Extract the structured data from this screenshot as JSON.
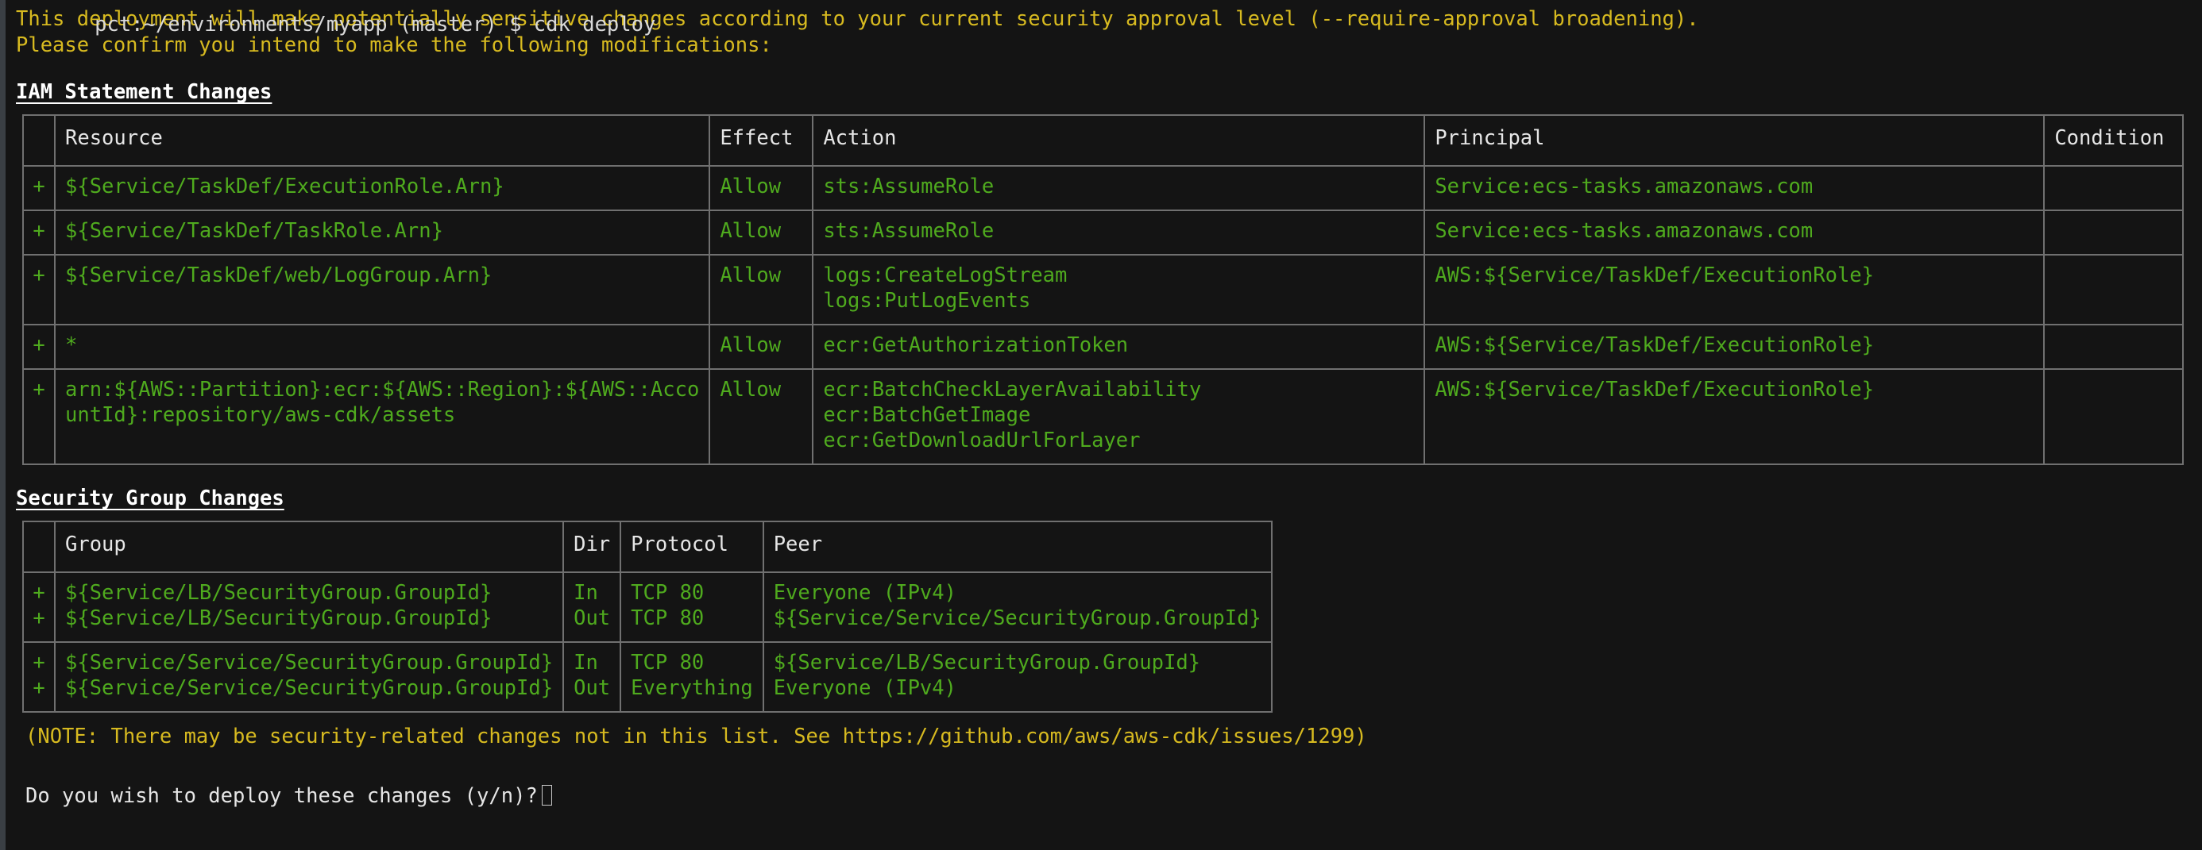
{
  "terminal": {
    "prompt_line_clipped": "pct:~/environments/myapp (master) $ cdk deploy",
    "warning_line_1": "This deployment will make potentially sensitive changes according to your current security approval level (--require-approval broadening).",
    "warning_line_2": "Please confirm you intend to make the following modifications:",
    "note": "(NOTE: There may be security-related changes not in this list. See https://github.com/aws/aws-cdk/issues/1299)",
    "confirm_prompt": "Do you wish to deploy these changes (y/n)?",
    "colors": {
      "background": "#141414",
      "warning": "#d7ba20",
      "added": "#4faa1e",
      "header_text": "#e6e6e6",
      "border": "#707070"
    }
  },
  "iam_section": {
    "title": "IAM Statement Changes",
    "columns": [
      "",
      "Resource",
      "Effect",
      "Action",
      "Principal",
      "Condition"
    ],
    "rows": [
      {
        "sign": "+",
        "resource": "${Service/TaskDef/ExecutionRole.Arn}",
        "effect": "Allow",
        "action": "sts:AssumeRole",
        "principal": "Service:ecs-tasks.amazonaws.com",
        "condition": ""
      },
      {
        "sign": "+",
        "resource": "${Service/TaskDef/TaskRole.Arn}",
        "effect": "Allow",
        "action": "sts:AssumeRole",
        "principal": "Service:ecs-tasks.amazonaws.com",
        "condition": ""
      },
      {
        "sign": "+",
        "resource": "${Service/TaskDef/web/LogGroup.Arn}",
        "effect": "Allow",
        "action": "logs:CreateLogStream\nlogs:PutLogEvents",
        "principal": "AWS:${Service/TaskDef/ExecutionRole}",
        "condition": ""
      },
      {
        "sign": "+",
        "resource": "*",
        "effect": "Allow",
        "action": "ecr:GetAuthorizationToken",
        "principal": "AWS:${Service/TaskDef/ExecutionRole}",
        "condition": ""
      },
      {
        "sign": "+",
        "resource": "arn:${AWS::Partition}:ecr:${AWS::Region}:${AWS::Acco\nuntId}:repository/aws-cdk/assets",
        "effect": "Allow",
        "action": "ecr:BatchCheckLayerAvailability\necr:BatchGetImage\necr:GetDownloadUrlForLayer",
        "principal": "AWS:${Service/TaskDef/ExecutionRole}",
        "condition": ""
      }
    ]
  },
  "sg_section": {
    "title": "Security Group Changes",
    "columns": [
      "",
      "Group",
      "Dir",
      "Protocol",
      "Peer"
    ],
    "rows": [
      {
        "sign": "+\n+",
        "group": "${Service/LB/SecurityGroup.GroupId}\n${Service/LB/SecurityGroup.GroupId}",
        "dir": "In\nOut",
        "protocol": "TCP 80\nTCP 80",
        "peer": "Everyone (IPv4)\n${Service/Service/SecurityGroup.GroupId}"
      },
      {
        "sign": "+\n+",
        "group": "${Service/Service/SecurityGroup.GroupId}\n${Service/Service/SecurityGroup.GroupId}",
        "dir": "In\nOut",
        "protocol": "TCP 80\nEverything",
        "peer": "${Service/LB/SecurityGroup.GroupId}\nEveryone (IPv4)"
      }
    ]
  }
}
